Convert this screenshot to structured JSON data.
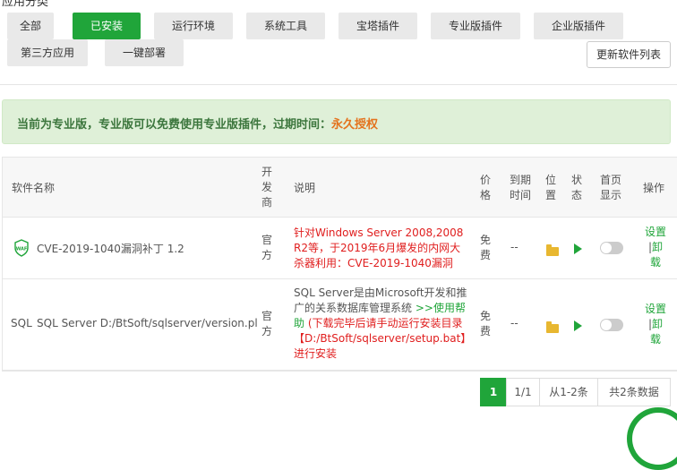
{
  "section_title": "应用分类",
  "tabs": [
    {
      "label": "全部",
      "active": false
    },
    {
      "label": "已安装",
      "active": true
    },
    {
      "label": "运行环境",
      "active": false
    },
    {
      "label": "系统工具",
      "active": false
    },
    {
      "label": "宝塔插件",
      "active": false
    },
    {
      "label": "专业版插件",
      "active": false
    },
    {
      "label": "企业版插件",
      "active": false
    },
    {
      "label": "第三方应用",
      "active": false
    },
    {
      "label": "一键部署",
      "active": false
    }
  ],
  "refresh_button": "更新软件列表",
  "notice": {
    "text": "当前为专业版，专业版可以免费使用专业版插件，过期时间：",
    "highlight": "永久授权"
  },
  "table": {
    "headers": {
      "name": "软件名称",
      "developer": [
        "开",
        "发",
        "商"
      ],
      "description": "说明",
      "price": [
        "价",
        "格"
      ],
      "expire": [
        "到期",
        "时间"
      ],
      "location": [
        "位",
        "置"
      ],
      "status": [
        "状",
        "态"
      ],
      "homepage": [
        "首页",
        "显示"
      ],
      "ops": "操作"
    },
    "rows": [
      {
        "icon": "waf-shield-icon",
        "name": "CVE-2019-1040漏洞补丁 1.2",
        "developer": [
          "官",
          "方"
        ],
        "description_lines": [
          "针对Windows Server 2008,2008",
          "R2等，于2019年6月爆发的内网大",
          "杀器利用：CVE-2019-1040漏洞"
        ],
        "price": [
          "免",
          "费"
        ],
        "expire": "--",
        "ops_settings": "设置",
        "ops_sep": "|",
        "ops_uninstall": [
          "卸",
          "载"
        ]
      },
      {
        "icon_text": "SQL",
        "name": "SQL Server D:/BtSoft/sqlserver/version.pl",
        "developer": [
          "官",
          "方"
        ],
        "description_lines": [
          "SQL Server是由Microsoft开发和推",
          "广的关系数据库管理系统"
        ],
        "description_link_inline": ">>使用帮",
        "description_link_line2": "助",
        "description_red_lines": [
          "(下载完毕后请手动运行安装目录",
          "【D:/BtSoft/sqlserver/setup.bat】",
          "进行安装"
        ],
        "price": [
          "免",
          "费"
        ],
        "expire": "--",
        "ops_settings": "设置",
        "ops_sep": "|",
        "ops_uninstall": [
          "卸",
          "载"
        ]
      }
    ]
  },
  "pagination": {
    "current": "1",
    "pages": "1/1",
    "range": "从1-2条",
    "total": "共2条数据"
  },
  "colors": {
    "accent": "#20a53a",
    "notice_bg": "#dff0d8",
    "notice_text": "#3c763d",
    "highlight": "#e4731e",
    "red_text": "#e01e1e"
  }
}
